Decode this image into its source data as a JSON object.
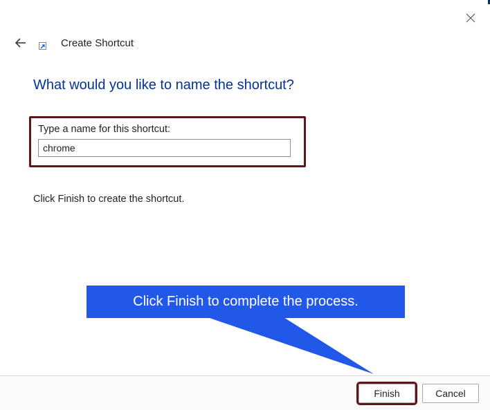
{
  "header": {
    "title": "Create Shortcut"
  },
  "question": "What would you like to name the shortcut?",
  "field": {
    "label": "Type a name for this shortcut:",
    "value": "chrome"
  },
  "instruction": "Click Finish to create the shortcut.",
  "callout": "Click Finish to complete the process.",
  "buttons": {
    "finish": "Finish",
    "cancel": "Cancel"
  }
}
